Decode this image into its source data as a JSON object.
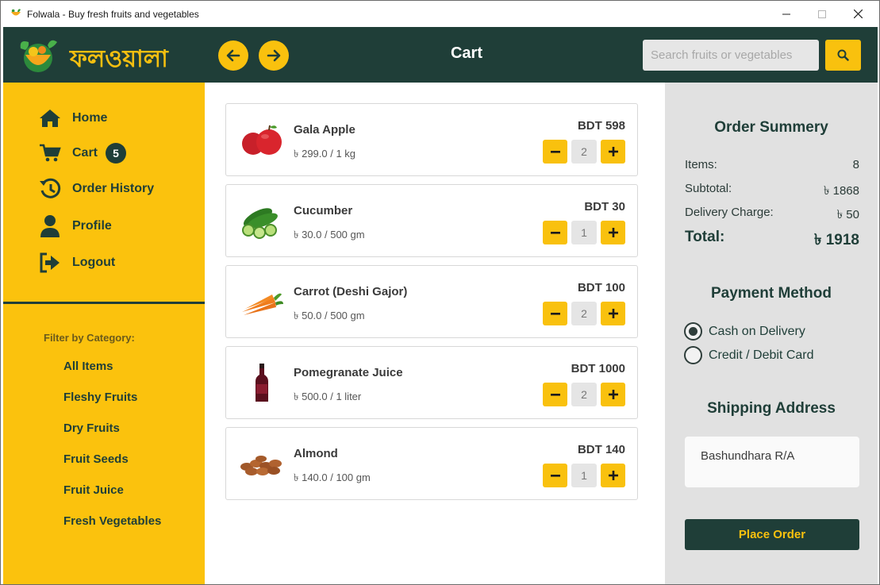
{
  "window": {
    "title": "Folwala - Buy fresh fruits and vegetables"
  },
  "header": {
    "logo_text": "ফলওয়ালা",
    "page_title": "Cart",
    "search_placeholder": "Search fruits or vegetables"
  },
  "sidebar": {
    "nav": [
      {
        "label": "Home",
        "icon": "home-icon"
      },
      {
        "label": "Cart",
        "icon": "cart-icon",
        "badge": "5"
      },
      {
        "label": "Order History",
        "icon": "history-icon"
      },
      {
        "label": "Profile",
        "icon": "user-icon"
      },
      {
        "label": "Logout",
        "icon": "logout-icon"
      }
    ],
    "filter_heading": "Filter by Category:",
    "categories": [
      "All Items",
      "Fleshy Fruits",
      "Dry Fruits",
      "Fruit Seeds",
      "Fruit Juice",
      "Fresh Vegetables"
    ]
  },
  "cart": {
    "items": [
      {
        "name": "Gala Apple",
        "unit_price": "৳ 299.0 / 1 kg",
        "total": "BDT 598",
        "qty": "2",
        "image": "apple-image"
      },
      {
        "name": "Cucumber",
        "unit_price": "৳ 30.0 / 500 gm",
        "total": "BDT 30",
        "qty": "1",
        "image": "cucumber-image"
      },
      {
        "name": "Carrot (Deshi Gajor)",
        "unit_price": "৳ 50.0 / 500 gm",
        "total": "BDT 100",
        "qty": "2",
        "image": "carrot-image"
      },
      {
        "name": "Pomegranate Juice",
        "unit_price": "৳ 500.0 / 1 liter",
        "total": "BDT 1000",
        "qty": "2",
        "image": "juice-bottle-image"
      },
      {
        "name": "Almond",
        "unit_price": "৳ 140.0 / 100 gm",
        "total": "BDT 140",
        "qty": "1",
        "image": "almond-image"
      }
    ]
  },
  "summary": {
    "heading": "Order Summery",
    "items_label": "Items:",
    "items_value": "8",
    "subtotal_label": "Subtotal:",
    "subtotal_value": "৳ 1868",
    "delivery_label": "Delivery Charge:",
    "delivery_value": "৳ 50",
    "total_label": "Total:",
    "total_value": "৳ 1918"
  },
  "payment": {
    "heading": "Payment Method",
    "options": [
      {
        "label": "Cash on Delivery",
        "selected": true
      },
      {
        "label": "Credit / Debit Card",
        "selected": false
      }
    ]
  },
  "shipping": {
    "heading": "Shipping Address",
    "address": "Bashundhara R/A"
  },
  "place_order_label": "Place Order",
  "colors": {
    "primary_dark": "#1f3e38",
    "accent_yellow": "#fbc20d",
    "panel_gray": "#e1e1e1"
  }
}
